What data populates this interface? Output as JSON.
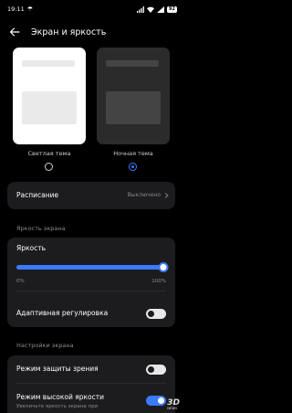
{
  "status_bar": {
    "time": "19:11",
    "battery": "92"
  },
  "header": {
    "title": "Экран и яркость"
  },
  "themes": {
    "light_label": "Светлая тема",
    "dark_label": "Ночная тема",
    "selected": "dark"
  },
  "schedule": {
    "label": "Расписание",
    "value": "Выключено"
  },
  "brightness_section": {
    "title": "Яркость экрана",
    "slider_label": "Яркость",
    "slider_level": 0.98,
    "min_label": "0%",
    "max_label": "100%",
    "adaptive_label": "Адаптивная регулировка",
    "adaptive_on": false
  },
  "display_section": {
    "title": "Настройки экрана",
    "eye_protection_label": "Режим защиты зрения",
    "eye_protection_on": false,
    "high_brightness_label": "Режим высокой яркости",
    "high_brightness_sub": "Увеличьте яркость экрана при",
    "high_brightness_on": true
  },
  "watermark": {
    "text": "3D",
    "sub": "NEWS"
  },
  "colors": {
    "accent": "#3a7bff",
    "card_bg": "#1c1c1e",
    "background": "#000000"
  }
}
